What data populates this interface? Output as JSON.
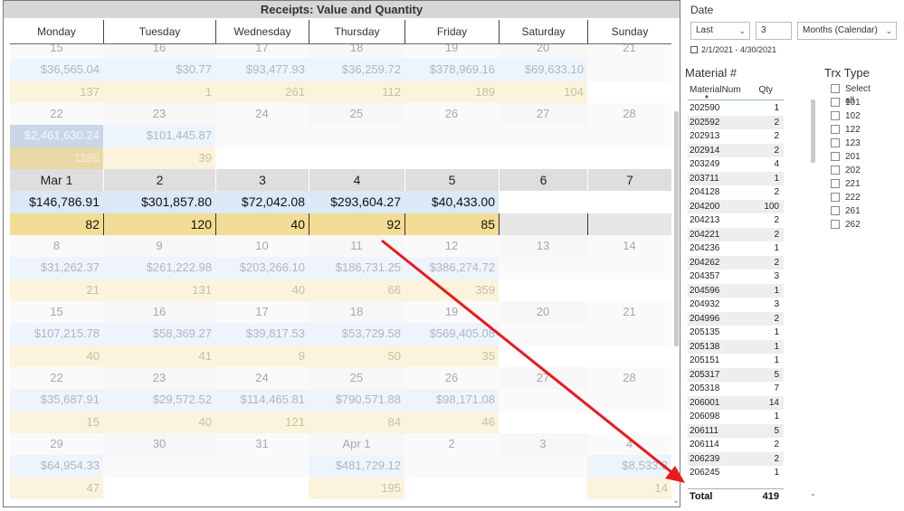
{
  "calendar": {
    "title": "Receipts: Value and Quantity",
    "weekdays": [
      "Monday",
      "Tuesday",
      "Wednesday",
      "Thursday",
      "Friday",
      "Saturday",
      "Sunday"
    ],
    "colors": {
      "value_bg": "#dbe8f6",
      "qty_bg": "#f3dc93",
      "empty_bg": "#e6e6e6",
      "day_bg_active": "#dedede"
    },
    "weeks": [
      {
        "faded": true,
        "partial": true,
        "days": [
          "15",
          "16",
          "17",
          "18",
          "19",
          "20",
          "21"
        ],
        "values": [
          "$36,565.04",
          "$30.77",
          "$93,477.93",
          "$36,259.72",
          "$378,969.16",
          "$69,633.10",
          ""
        ],
        "qtys": [
          "137",
          "1",
          "261",
          "112",
          "189",
          "104",
          ""
        ]
      },
      {
        "faded": true,
        "days": [
          "22",
          "23",
          "24",
          "25",
          "26",
          "27",
          "28"
        ],
        "values": [
          "$2,461,630.24",
          "$101,445.87",
          "",
          "",
          "",
          "",
          ""
        ],
        "qtys": [
          "1186",
          "39",
          "",
          "",
          "",
          "",
          ""
        ]
      },
      {
        "faded": false,
        "days": [
          "Mar 1",
          "2",
          "3",
          "4",
          "5",
          "6",
          "7"
        ],
        "values": [
          "$146,786.91",
          "$301,857.80",
          "$72,042.08",
          "$293,604.27",
          "$40,433.00",
          "",
          ""
        ],
        "qtys": [
          "82",
          "120",
          "40",
          "92",
          "85",
          "",
          ""
        ]
      },
      {
        "faded": true,
        "days": [
          "8",
          "9",
          "10",
          "11",
          "12",
          "13",
          "14"
        ],
        "values": [
          "$31,262.37",
          "$261,222.98",
          "$203,266.10",
          "$186,731.25",
          "$386,274.72",
          "",
          ""
        ],
        "qtys": [
          "21",
          "131",
          "40",
          "66",
          "359",
          "",
          ""
        ]
      },
      {
        "faded": true,
        "days": [
          "15",
          "16",
          "17",
          "18",
          "19",
          "20",
          "21"
        ],
        "values": [
          "$107,215.78",
          "$58,369.27",
          "$39,817.53",
          "$53,729.58",
          "$569,405.08",
          "",
          ""
        ],
        "qtys": [
          "40",
          "41",
          "9",
          "50",
          "35",
          "",
          ""
        ]
      },
      {
        "faded": true,
        "days": [
          "22",
          "23",
          "24",
          "25",
          "26",
          "27",
          "28"
        ],
        "values": [
          "$35,687.91",
          "$29,572.52",
          "$114,465.81",
          "$790,571.88",
          "$98,171.08",
          "",
          ""
        ],
        "qtys": [
          "15",
          "40",
          "121",
          "84",
          "46",
          "",
          ""
        ]
      },
      {
        "faded": true,
        "days": [
          "29",
          "30",
          "31",
          "Apr 1",
          "2",
          "3",
          "4"
        ],
        "values": [
          "$64,954.33",
          "",
          "",
          "$481,729.12",
          "",
          "",
          "$8,533.8"
        ],
        "qtys": [
          "47",
          "",
          "",
          "195",
          "",
          "",
          "14"
        ]
      }
    ]
  },
  "date_slicer": {
    "title": "Date",
    "period_type": "Last",
    "period_count": "3",
    "period_unit": "Months (Calendar)",
    "range": "2/1/2021 - 4/30/2021"
  },
  "material": {
    "title": "Material #",
    "col_material": "MaterialNum",
    "col_qty": "Qty",
    "rows": [
      [
        "202590",
        "1"
      ],
      [
        "202592",
        "2"
      ],
      [
        "202913",
        "2"
      ],
      [
        "202914",
        "2"
      ],
      [
        "203249",
        "4"
      ],
      [
        "203711",
        "1"
      ],
      [
        "204128",
        "2"
      ],
      [
        "204200",
        "100"
      ],
      [
        "204213",
        "2"
      ],
      [
        "204221",
        "2"
      ],
      [
        "204236",
        "1"
      ],
      [
        "204262",
        "2"
      ],
      [
        "204357",
        "3"
      ],
      [
        "204596",
        "1"
      ],
      [
        "204932",
        "3"
      ],
      [
        "204996",
        "2"
      ],
      [
        "205135",
        "1"
      ],
      [
        "205138",
        "1"
      ],
      [
        "205151",
        "1"
      ],
      [
        "205317",
        "5"
      ],
      [
        "205318",
        "7"
      ],
      [
        "206001",
        "14"
      ],
      [
        "206098",
        "1"
      ],
      [
        "206111",
        "5"
      ],
      [
        "206114",
        "2"
      ],
      [
        "206239",
        "2"
      ],
      [
        "206245",
        "1"
      ]
    ],
    "total_label": "Total",
    "total_value": "419"
  },
  "trx_type": {
    "title": "Trx Type",
    "items": [
      "Select all",
      "101",
      "102",
      "122",
      "123",
      "201",
      "202",
      "221",
      "222",
      "261",
      "262"
    ]
  },
  "annotation": {
    "arrow_color": "#e8191e"
  }
}
